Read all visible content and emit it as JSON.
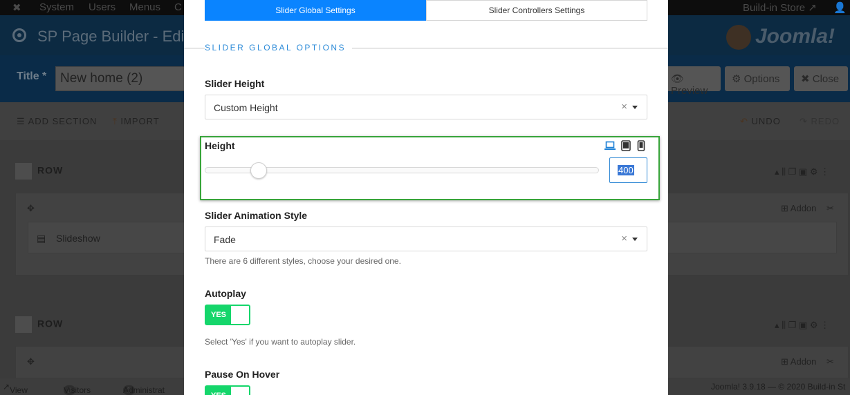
{
  "topnav": {
    "items": [
      "System",
      "Users",
      "Menus",
      "C"
    ],
    "store": "Build-in Store"
  },
  "header": {
    "title": "SP Page Builder - Edit P",
    "logo": "Joomla!"
  },
  "titlerow": {
    "label": "Title *",
    "value": "New home (2)",
    "buttons": [
      "Preview",
      "Options",
      "Close"
    ]
  },
  "toolbar": {
    "add_section": "ADD SECTION",
    "import": "IMPORT",
    "undo": "UNDO",
    "redo": "REDO"
  },
  "rows": {
    "row1": "ROW",
    "row2": "ROW",
    "addon_label": "Addon",
    "addon_name": "Slideshow"
  },
  "statusbar": {
    "view_site": "View Site",
    "visitors_count": "0",
    "visitors": "Visitors",
    "admin_count": "1",
    "admin": "Administrat",
    "version": "Joomla! 3.9.18 — © 2020 Build-in St"
  },
  "modal": {
    "tabs": [
      "Slider Global Settings",
      "Slider Controllers Settings"
    ],
    "active_tab": 0,
    "section_title": "SLIDER GLOBAL OPTIONS",
    "slider_height": {
      "label": "Slider Height",
      "value": "Custom Height"
    },
    "height": {
      "label": "Height",
      "value": "400",
      "level": 0.12,
      "devices": [
        "laptop-icon",
        "tablet-icon",
        "mobile-icon"
      ],
      "active_device": "laptop-icon"
    },
    "animation": {
      "label": "Slider Animation Style",
      "value": "Fade",
      "help": "There are 6 different styles, choose your desired one."
    },
    "autoplay": {
      "label": "Autoplay",
      "state": "YES",
      "help": "Select 'Yes' if you want to autoplay slider."
    },
    "pause_on_hover": {
      "label": "Pause On Hover",
      "state": "YES"
    }
  },
  "colors": {
    "accent": "#0a84ff",
    "toggle_on": "#15d66b",
    "highlight": "#38a43a",
    "section": "#2d8bd8"
  }
}
